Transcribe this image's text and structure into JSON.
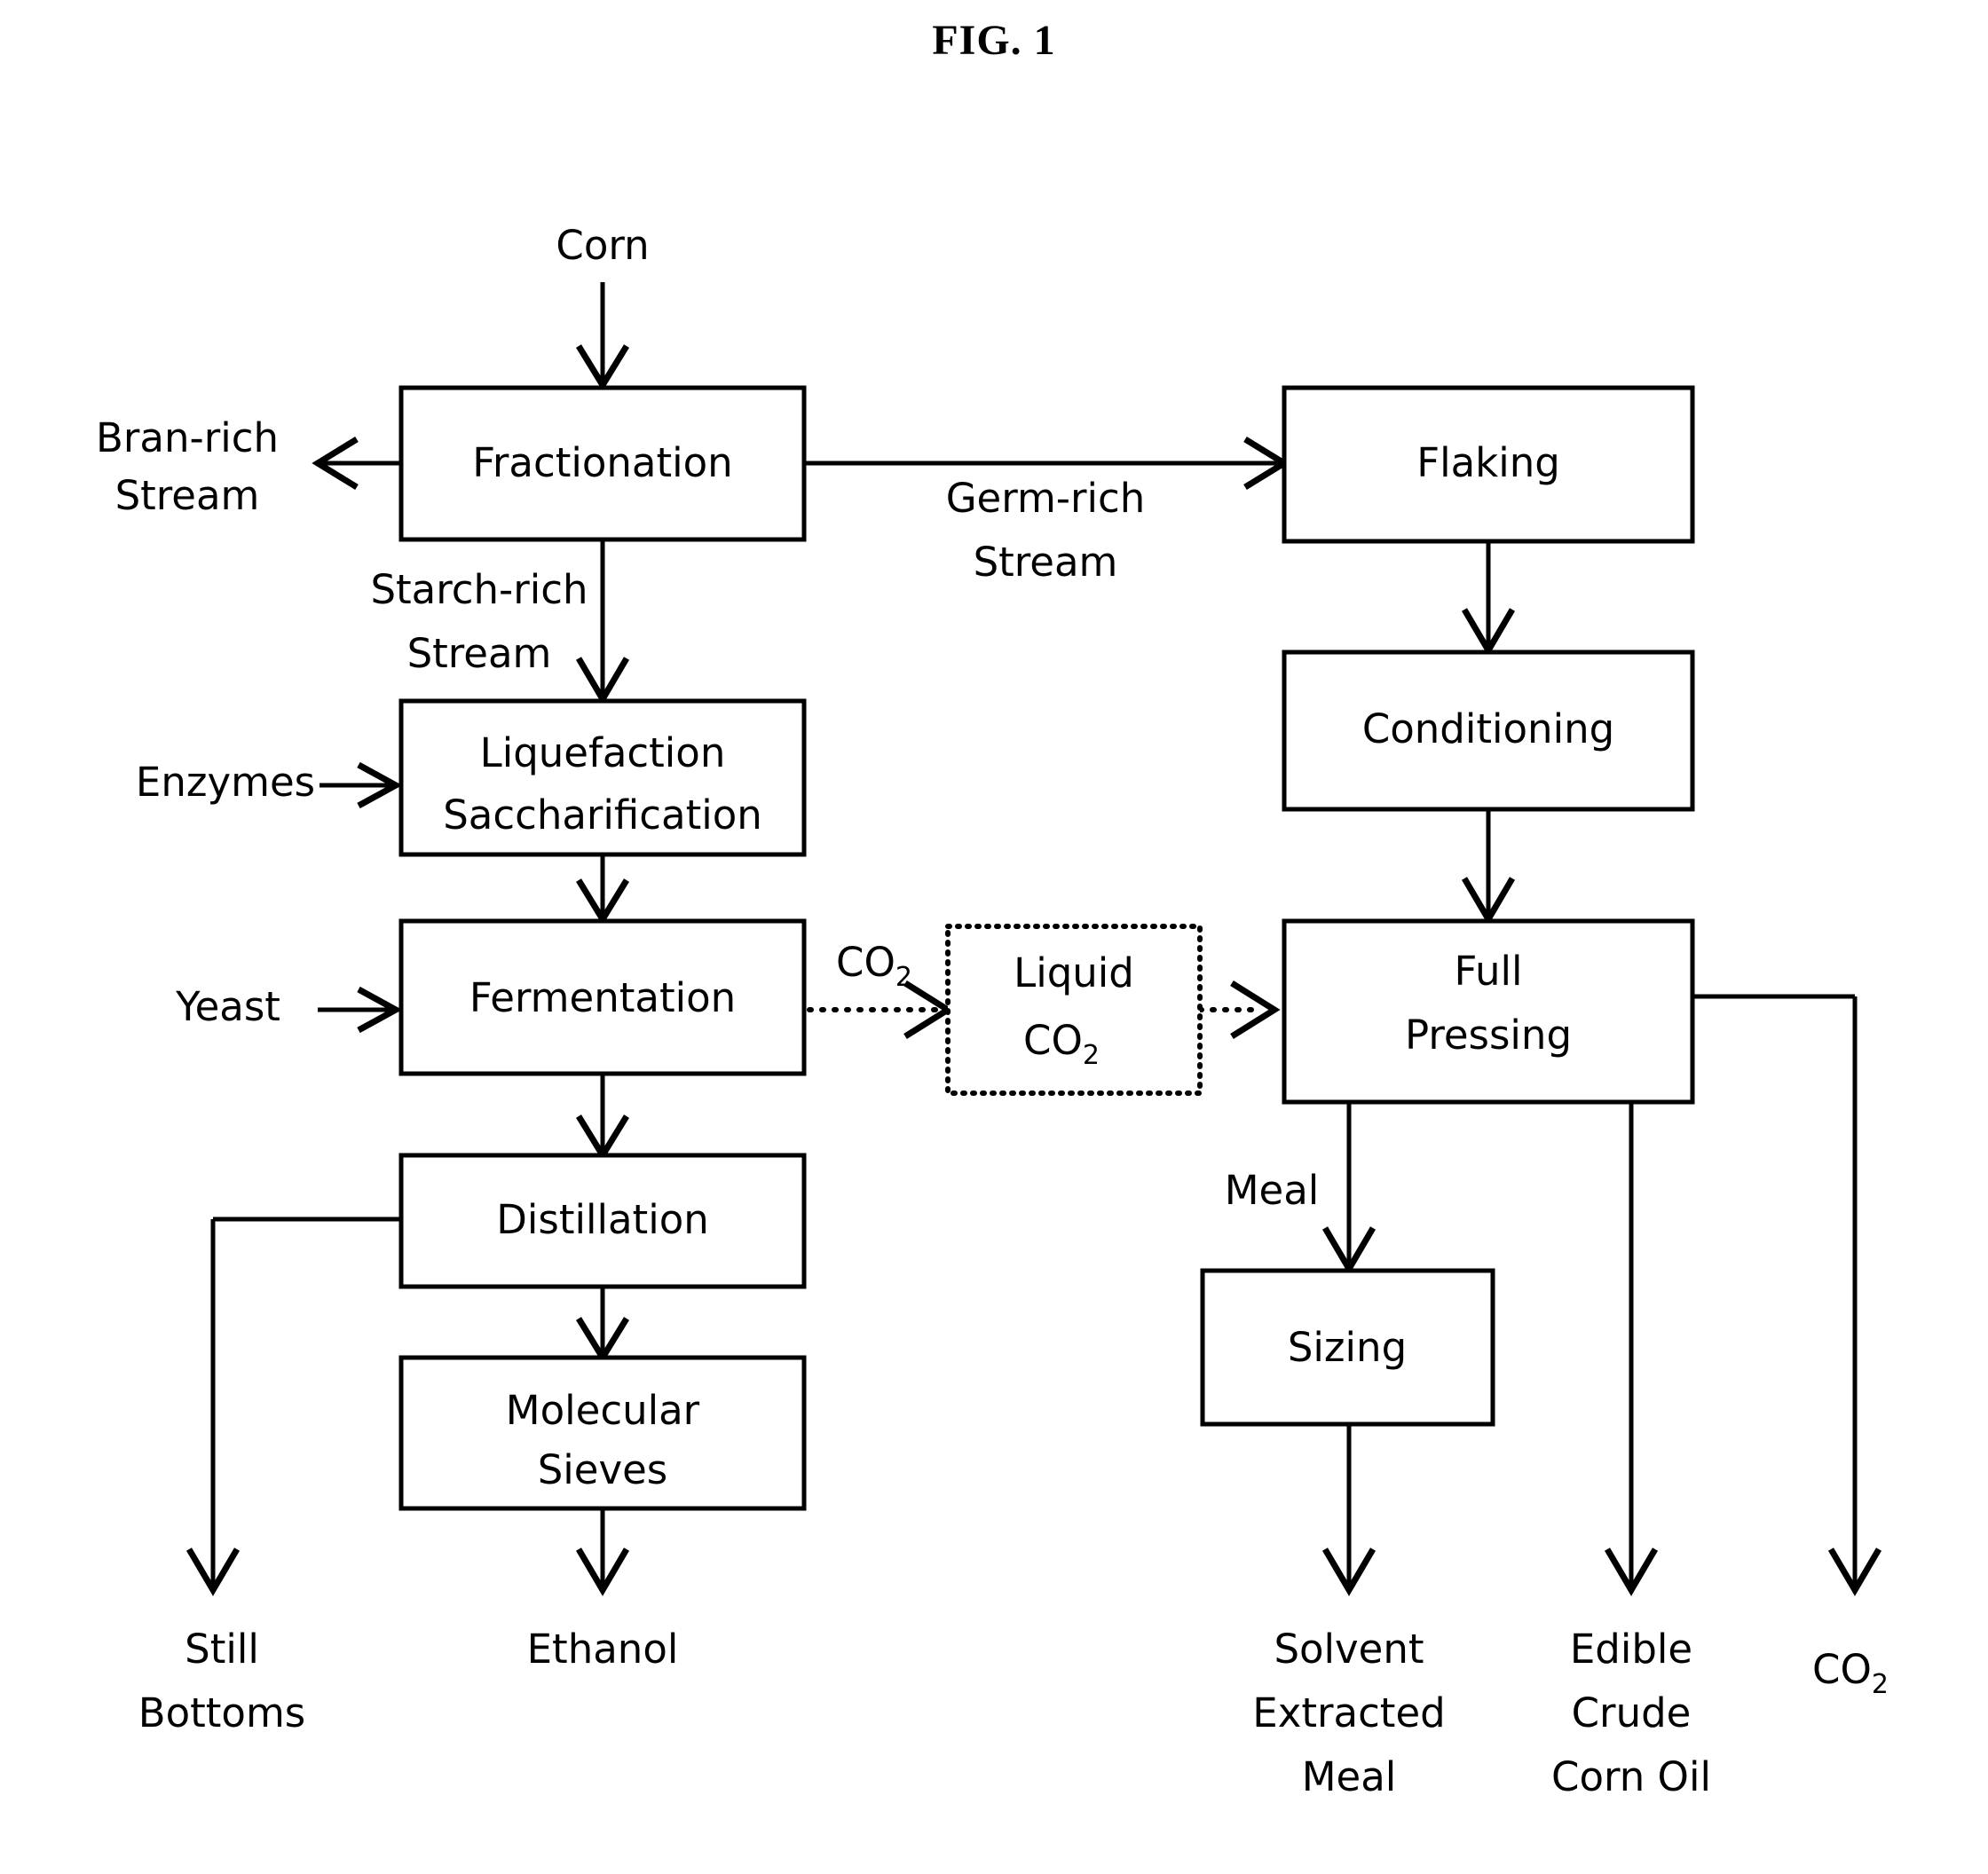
{
  "figure": {
    "title": "FIG. 1",
    "type": "process-flow-diagram",
    "background_color": "#ffffff",
    "line_color": "#000000"
  },
  "boxes": {
    "fractionation": {
      "label": "Fractionation",
      "border": "solid"
    },
    "liquefaction": {
      "line1": "Liquefaction",
      "line2": "Saccharification",
      "border": "solid"
    },
    "fermentation": {
      "label": "Fermentation",
      "border": "solid"
    },
    "distillation": {
      "label": "Distillation",
      "border": "solid"
    },
    "molecular_sieves": {
      "line1": "Molecular",
      "line2": "Sieves",
      "border": "solid"
    },
    "flaking": {
      "label": "Flaking",
      "border": "solid"
    },
    "conditioning": {
      "label": "Conditioning",
      "border": "solid"
    },
    "full_pressing": {
      "line1": "Full",
      "line2": "Pressing",
      "border": "solid"
    },
    "sizing": {
      "label": "Sizing",
      "border": "solid"
    },
    "liquid_co2": {
      "line1": "Liquid",
      "line2_base": "CO",
      "line2_sub": "2",
      "border": "dotted"
    }
  },
  "inputs": {
    "corn": "Corn",
    "enzymes": "Enzymes",
    "yeast": "Yeast"
  },
  "stream_labels": {
    "bran_rich_1": "Bran-rich",
    "bran_rich_2": "Stream",
    "starch_rich_1": "Starch-rich",
    "starch_rich_2": "Stream",
    "germ_rich_1": "Germ-rich",
    "germ_rich_2": "Stream",
    "co2_base": "CO",
    "co2_sub": "2",
    "meal": "Meal"
  },
  "outputs": {
    "still_bottoms_1": "Still",
    "still_bottoms_2": "Bottoms",
    "ethanol": "Ethanol",
    "solvent_meal_1": "Solvent",
    "solvent_meal_2": "Extracted",
    "solvent_meal_3": "Meal",
    "corn_oil_1": "Edible",
    "corn_oil_2": "Crude",
    "corn_oil_3": "Corn Oil",
    "co2_base": "CO",
    "co2_sub": "2"
  }
}
